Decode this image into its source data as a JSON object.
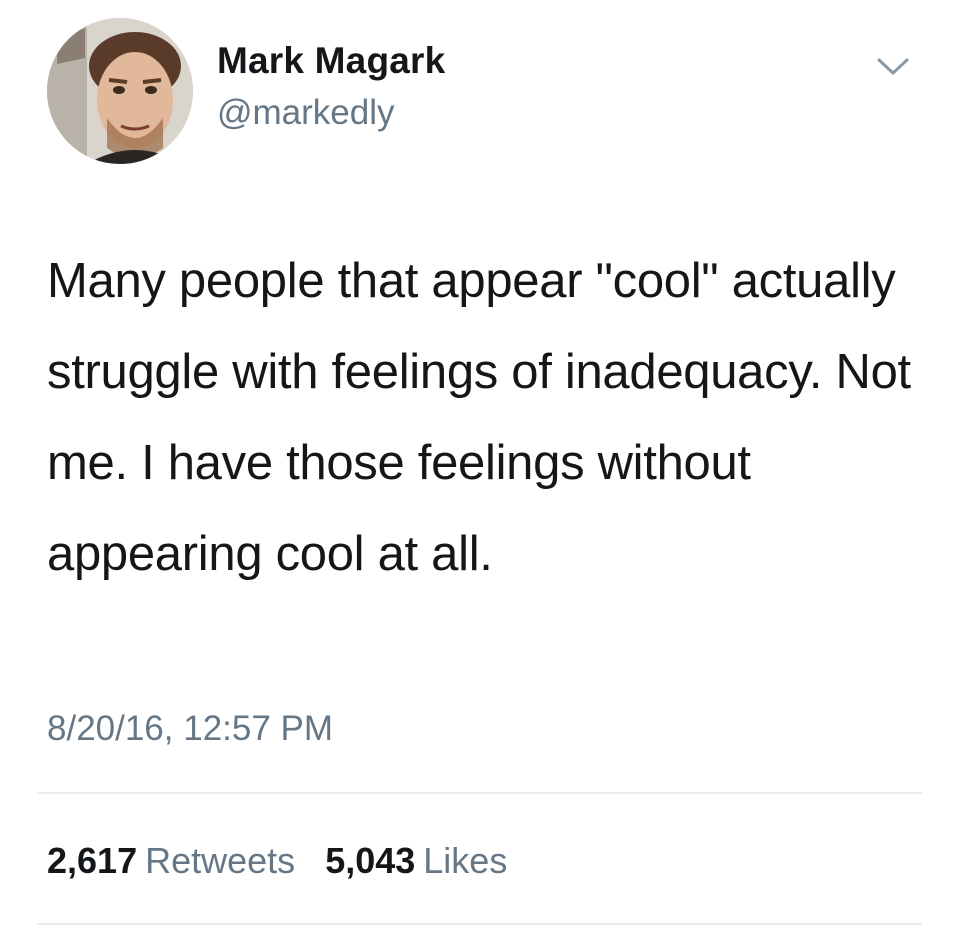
{
  "author": {
    "name": "Mark Magark",
    "handle": "@markedly"
  },
  "tweet": {
    "text": "Many people that appear \"cool\" actually struggle with feelings of inadequacy. Not me. I have those feelings without appearing cool at all.",
    "timestamp": "8/20/16, 12:57 PM"
  },
  "stats": {
    "retweets_count": "2,617",
    "retweets_label": "Retweets",
    "likes_count": "5,043",
    "likes_label": "Likes"
  },
  "icons": {
    "menu": "chevron-down-icon"
  },
  "colors": {
    "text": "#14171a",
    "secondary": "#657786",
    "divider": "#e6ecf0"
  }
}
